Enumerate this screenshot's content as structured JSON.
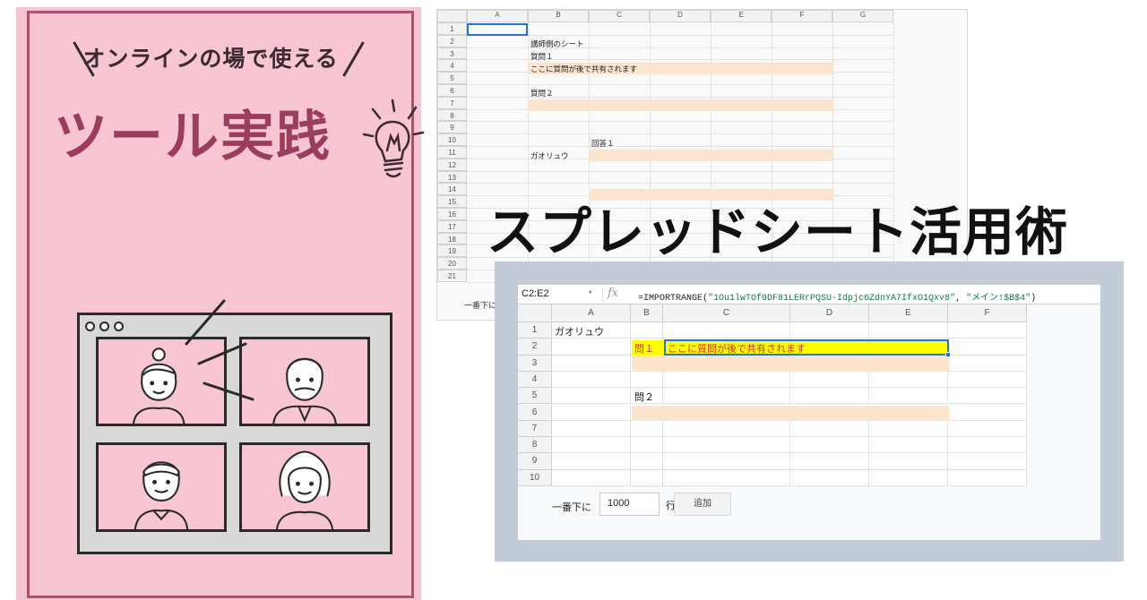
{
  "poster": {
    "subtitle": "オンラインの場で使える",
    "title": "ツール実践"
  },
  "headline": "スプレッドシート活用術",
  "back_sheet": {
    "columns": [
      "A",
      "B",
      "C",
      "D",
      "E",
      "F",
      "G"
    ],
    "rows": [
      "1",
      "2",
      "3",
      "4",
      "5",
      "6",
      "7",
      "8",
      "9",
      "10",
      "11",
      "12",
      "13",
      "14",
      "15",
      "16",
      "17",
      "18",
      "19",
      "20",
      "21"
    ],
    "cells": {
      "b2": "講師側のシート",
      "b3": "質問１",
      "b4": "ここに質問が後で共有されます",
      "b6": "質問２",
      "c10": "回答１",
      "b11": "ガオリュウ"
    },
    "footer_label": "一番下に"
  },
  "front_sheet": {
    "name_box": "C2:E2",
    "fx_label": "fx",
    "formula_prefix": "=IMPORTRANGE(",
    "formula_arg1": "\"1Ou1lwTOf9DF81LERrPQSU-Idpjc6ZdnYA7IfxO1Qxv8\"",
    "formula_sep": ", ",
    "formula_arg2": "\"メイン!$B$4\"",
    "formula_suffix": ")",
    "columns": [
      "A",
      "B",
      "C",
      "D",
      "E",
      "F"
    ],
    "rows": [
      "1",
      "2",
      "3",
      "4",
      "5",
      "6",
      "7",
      "8",
      "9",
      "10"
    ],
    "cells": {
      "a1": "ガオリュウ",
      "b2": "問１",
      "c2": "ここに質問が後で共有されます",
      "b5": "問２"
    },
    "footer_label": "一番下に",
    "rows_value": "1000",
    "rows_unit": "行",
    "add_label": "追加"
  },
  "colors": {
    "poster_bg": "#f8c6d3",
    "poster_title": "#9b3d5f",
    "highlight": "#ffff00",
    "question_fill": "#fce5cd",
    "selection": "#1a73e8"
  }
}
